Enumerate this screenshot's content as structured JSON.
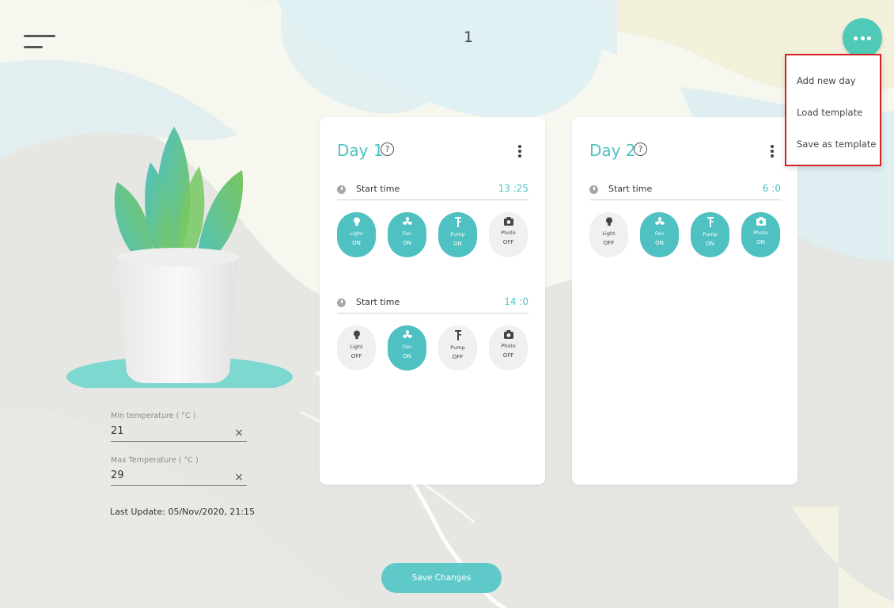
{
  "header": {
    "page_number": "1"
  },
  "menu": {
    "items": [
      "Add new day",
      "Load template",
      "Save as template"
    ]
  },
  "temperature": {
    "min_label": "Min temperature ( °C )",
    "min_value": "21",
    "max_label": "Max Temperature ( °C )",
    "max_value": "29",
    "clear_glyph": "×"
  },
  "last_update": "Last Update: 05/Nov/2020, 21:15",
  "days": [
    {
      "title": "Day 1",
      "slots": [
        {
          "label": "Start time",
          "time": "13 :25",
          "devices": [
            {
              "name": "Light",
              "status": "ON"
            },
            {
              "name": "Fan",
              "status": "ON"
            },
            {
              "name": "Pump",
              "status": "ON"
            },
            {
              "name": "Photo",
              "status": "OFF"
            }
          ]
        },
        {
          "label": "Start time",
          "time": "14 :0",
          "devices": [
            {
              "name": "Light",
              "status": "OFF"
            },
            {
              "name": "Fan",
              "status": "ON"
            },
            {
              "name": "Pump",
              "status": "OFF"
            },
            {
              "name": "Photo",
              "status": "OFF"
            }
          ]
        }
      ]
    },
    {
      "title": "Day 2",
      "slots": [
        {
          "label": "Start time",
          "time": "6 :0",
          "devices": [
            {
              "name": "Light",
              "status": "OFF"
            },
            {
              "name": "Fan",
              "status": "ON"
            },
            {
              "name": "Pump",
              "status": "ON"
            },
            {
              "name": "Photo",
              "status": "ON"
            }
          ]
        }
      ]
    }
  ],
  "icons": {
    "menu": "hamburger-icon",
    "more": "more-dots-icon",
    "help": "question-icon",
    "options": "kebab-icon",
    "clock": "clock-icon",
    "devices": [
      "lightbulb-icon",
      "fan-icon",
      "pump-icon",
      "camera-icon"
    ]
  },
  "actions": {
    "save_label": "Save Changes"
  },
  "colors": {
    "accent": "#4fc1c2",
    "menu_highlight": "#d42020",
    "device_on": "#4fc1c2",
    "device_off": "#f0f0f0"
  }
}
